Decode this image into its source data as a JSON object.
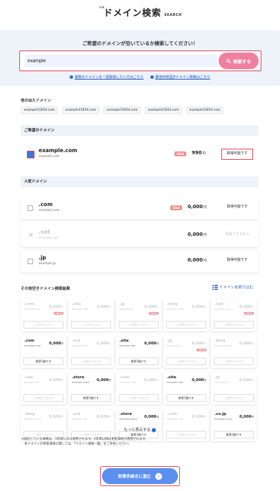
{
  "header": {
    "title": "ドメイン検索",
    "sub": "SEARCH"
  },
  "colors": {
    "accent": "#e14354",
    "search_btn": "#f07fa0",
    "primary": "#5b8ff0",
    "dot1": "#f07fa0",
    "dot2": "#5b8ff0"
  },
  "search": {
    "lead": "ご希望のドメインが空いているか検索してください！",
    "value": "example",
    "button": "検索する",
    "link1": "複数のドメインを一括取得したい方はこちら",
    "link2": "都道府県型JPドメイン検索はこちら"
  },
  "similar": {
    "title": "他の似たドメイン",
    "items": [
      "example15654.com",
      "example15654.com",
      "example15654.com",
      "example15654.com",
      "example15654.com"
    ]
  },
  "wanted": {
    "title": "ご希望のドメイン",
    "domain": "example.com",
    "sub": "example.com",
    "sale": "SALE",
    "price": "990",
    "yen": "円",
    "status": "取得可能です"
  },
  "popular": {
    "title": "人気ドメイン",
    "items": [
      {
        "tld": ".com",
        "sub": "example.com",
        "sale": "SALE",
        "price": "0,000",
        "yen": "円",
        "status": "取得可能です",
        "disabled": false
      },
      {
        "tld": ".net",
        "sub": "example.net",
        "sale": "",
        "price": "0,000",
        "yen": "円",
        "status": "取得できません",
        "disabled": true
      },
      {
        "tld": ".jp",
        "sub": "example.jp",
        "sale": "",
        "price": "0,000",
        "yen": "円",
        "status": "取得可能です",
        "disabled": false
      }
    ]
  },
  "others": {
    "title": "その他空きドメイン検索結果",
    "filter": "ドメインを絞り込む",
    "items": [
      {
        "tld": ".com",
        "sub": "example.com",
        "price": "0,000",
        "yen": "円",
        "sale": "SALE",
        "status": "あみなさせん",
        "disabled": true
      },
      {
        "tld": ".site",
        "sub": "example.site",
        "price": "0,000",
        "yen": "円",
        "sale": "",
        "status": "あみなさせん",
        "disabled": true
      },
      {
        "tld": ".jp",
        "sub": "example.jp",
        "price": "0,000",
        "yen": "円",
        "sale": "SALE",
        "status": "取得できません",
        "disabled": true
      },
      {
        "tld": ".blog",
        "sub": "example.blog",
        "price": "0,000",
        "yen": "円",
        "sale": "",
        "status": "取得できません",
        "disabled": true
      },
      {
        "tld": ".red",
        "sub": "example.red",
        "price": "0,000",
        "yen": "円",
        "sale": "SALE",
        "status": "取得できません",
        "disabled": true
      },
      {
        "tld": ".com",
        "sub": "example.com",
        "price": "0,000",
        "yen": "円",
        "sale": "",
        "status": "取得可能です",
        "disabled": false
      },
      {
        "tld": ".red",
        "sub": "example.red",
        "price": "0,000",
        "yen": "円",
        "sale": "",
        "status": "取得できません",
        "disabled": true
      },
      {
        "tld": ".site",
        "sub": "example.site",
        "price": "0,000",
        "yen": "円",
        "sale": "",
        "status": "取得可能です",
        "disabled": false
      },
      {
        "tld": ".jp",
        "sub": "example.jp",
        "price": "0,000",
        "yen": "円",
        "sale": "SALE",
        "status": "取得できません",
        "disabled": true
      },
      {
        "tld": ".blog",
        "sub": "example.blog",
        "price": "0,000",
        "yen": "円",
        "sale": "",
        "status": "取得できません",
        "disabled": true
      },
      {
        "tld": ".red",
        "sub": "example.red",
        "price": "0,000",
        "yen": "円",
        "sale": "",
        "status": "取得できません",
        "disabled": true
      },
      {
        "tld": ".store",
        "sub": "example.store",
        "price": "0,000",
        "yen": "円",
        "sale": "",
        "status": "取得可能です",
        "disabled": false
      },
      {
        "tld": ".com",
        "sub": "example.com",
        "price": "0,000",
        "yen": "円",
        "sale": "",
        "status": "取得できません",
        "disabled": true
      },
      {
        "tld": ".site",
        "sub": "example.site",
        "price": "0,000",
        "yen": "円",
        "sale": "",
        "status": "取得可能です",
        "disabled": false
      },
      {
        "tld": ".jp",
        "sub": "example.jp",
        "price": "0,000",
        "yen": "円",
        "sale": "",
        "status": "取得できません",
        "disabled": true
      },
      {
        "tld": ".blog",
        "sub": "example.blog",
        "price": "0,000",
        "yen": "円",
        "sale": "",
        "status": "取得できません",
        "disabled": true
      },
      {
        "tld": ".red",
        "sub": "example.red",
        "price": "0,000",
        "yen": "円",
        "sale": "",
        "status": "取得できません",
        "disabled": true
      },
      {
        "tld": ".store",
        "sub": "example.store",
        "price": "0,000",
        "yen": "円",
        "sale": "",
        "status": "取得可能です",
        "disabled": false
      },
      {
        "tld": ".com",
        "sub": "example.com",
        "price": "0,000",
        "yen": "円",
        "sale": "",
        "status": "取得できません",
        "disabled": true
      },
      {
        "tld": ".co.jp",
        "sub": "example.co.jp",
        "price": "0,000",
        "yen": "円",
        "sale": "",
        "status": "取得可能です",
        "disabled": false
      }
    ]
  },
  "more": "もっと表示する",
  "note": "※表記している価格は、1年目にのみ適用されます。2年目以降は更新価格が適用されます。\n　各ドメインの更新価格に関しては、「ドメイン価格一覧」をご参照ください。",
  "proceed": "取得手続きに進む"
}
